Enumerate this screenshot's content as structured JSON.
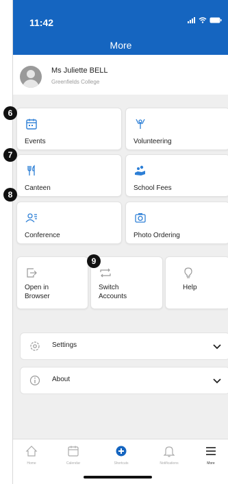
{
  "status": {
    "time": "11:42"
  },
  "header": {
    "title": "More"
  },
  "profile": {
    "name": "Ms Juliette BELL",
    "school": "Greenfields College"
  },
  "grid": [
    {
      "label": "Events",
      "icon": "calendar-icon"
    },
    {
      "label": "Volunteering",
      "icon": "volunteer-icon"
    },
    {
      "label": "Canteen",
      "icon": "cutlery-icon"
    },
    {
      "label": "School Fees",
      "icon": "coins-icon"
    },
    {
      "label": "Conference",
      "icon": "conference-icon"
    },
    {
      "label": "Photo Ordering",
      "icon": "camera-icon"
    }
  ],
  "actions": [
    {
      "line1": "Open in",
      "line2": "Browser",
      "icon": "open-external-icon"
    },
    {
      "line1": "Switch",
      "line2": "Accounts",
      "icon": "switch-icon"
    },
    {
      "line1": "Help",
      "line2": "",
      "icon": "lightbulb-icon"
    }
  ],
  "settings": {
    "label": "Settings"
  },
  "about": {
    "label": "About"
  },
  "steps": [
    "6",
    "7",
    "8",
    "9"
  ],
  "tabs": [
    {
      "label": "Home",
      "icon": "home-icon"
    },
    {
      "label": "Calendar",
      "icon": "calendar-icon"
    },
    {
      "label": "Shortcuts",
      "icon": "plus-circle-icon"
    },
    {
      "label": "Notifications",
      "icon": "bell-icon"
    },
    {
      "label": "More",
      "icon": "menu-icon"
    }
  ],
  "colors": {
    "header": "#1565c0",
    "accent": "#2d7fd6",
    "background": "#efefef"
  }
}
